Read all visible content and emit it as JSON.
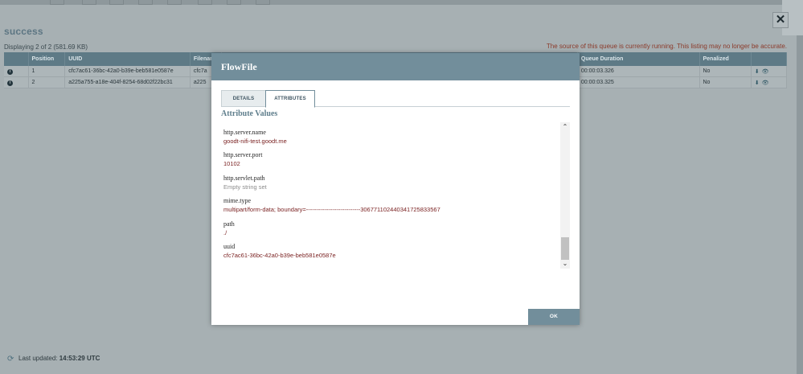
{
  "queue": {
    "title": "success",
    "displaying": "Displaying 2 of 2 (581.69 KB)",
    "warning": "The source of this queue is currently running. This listing may no longer be accurate.",
    "close_icon": "close-icon"
  },
  "table": {
    "headers": [
      "",
      "Position",
      "UUID",
      "Filename",
      "",
      "Queue Duration",
      "Penalized",
      ""
    ],
    "rows": [
      {
        "position": "1",
        "uuid": "cfc7ac61-36bc-42a0-b39e-beb581e0587e",
        "filename": "cfc7a",
        "duration": "00:00:03.326",
        "penalized": "No"
      },
      {
        "position": "2",
        "uuid": "a225a755-a18e-404f-8254-68d02f22bc31",
        "filename": "a225",
        "duration": "00:00:03.325",
        "penalized": "No"
      }
    ]
  },
  "footer": {
    "last_updated_label": "Last updated:",
    "last_updated_value": "14:53:29 UTC"
  },
  "modal": {
    "title": "FlowFile",
    "tabs": [
      "DETAILS",
      "ATTRIBUTES"
    ],
    "active_tab": "ATTRIBUTES",
    "section_title": "Attribute Values",
    "attributes": [
      {
        "name": "http.server.name",
        "value": "goodt-nifi-test.goodt.me"
      },
      {
        "name": "http.server.port",
        "value": "10102"
      },
      {
        "name": "http.servlet.path",
        "value": "Empty string set"
      },
      {
        "name": "mime.type",
        "value": "multipart/form-data; boundary=---------------------------306771102440341725833567"
      },
      {
        "name": "path",
        "value": "./"
      },
      {
        "name": "uuid",
        "value": "cfc7ac61-36bc-42a0-b39e-beb581e0587e"
      }
    ],
    "ok_label": "OK"
  },
  "colors": {
    "accent": "#728e9b",
    "value_text": "#7b2323",
    "warning": "#8b3a2a"
  }
}
